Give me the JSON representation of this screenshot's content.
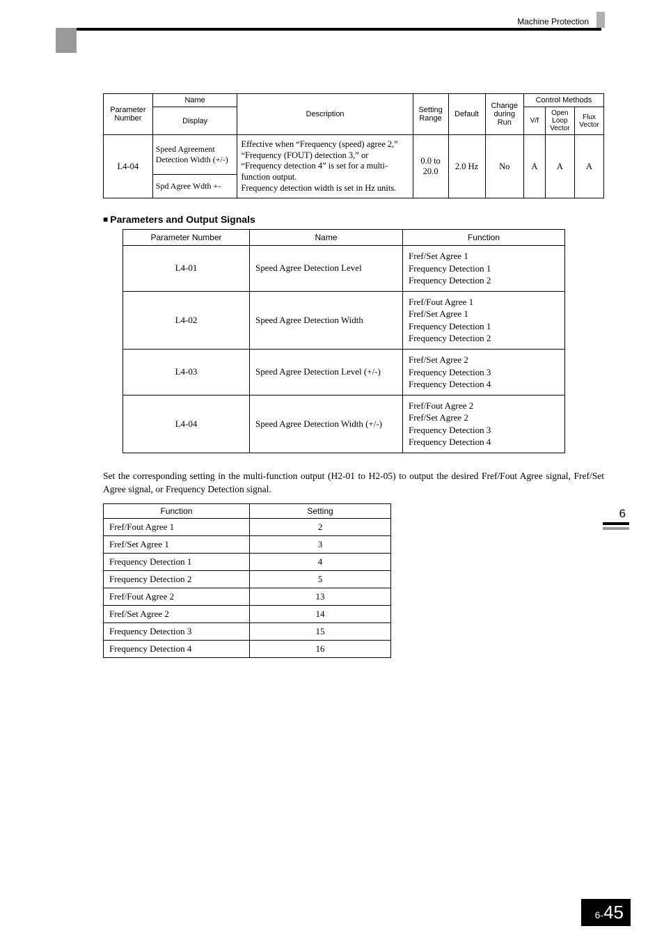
{
  "header": {
    "label": "Machine Protection"
  },
  "table1": {
    "head": {
      "param_no": "Parameter Number",
      "name": "Name",
      "display": "Display",
      "desc": "Description",
      "range": "Setting Range",
      "default": "Default",
      "change": "Change during Run",
      "control": "Control Methods",
      "vf": "V/f",
      "olv": "Open Loop Vector",
      "flux": "Flux Vector"
    },
    "row": {
      "pn": "L4-04",
      "name": "Speed Agreement Detection Width (+/-)",
      "disp": "Spd Agree Wdth +-",
      "desc": "Effective when “Frequency (speed) agree 2,” “Frequency (FOUT) detection 3,” or “Frequency detection 4” is set for a multi-function output.\nFrequency detection width is set in Hz units.",
      "range": "0.0 to 20.0",
      "default": "2.0 Hz",
      "change": "No",
      "vf": "A",
      "olv": "A",
      "flux": "A"
    }
  },
  "section": {
    "title": "Parameters and Output Signals"
  },
  "table2": {
    "head": {
      "pn": "Parameter Number",
      "name": "Name",
      "fn": "Function"
    },
    "rows": [
      {
        "pn": "L4-01",
        "name": "Speed Agree Detection Level",
        "fn": "Fref/Set Agree 1\nFrequency Detection 1\nFrequency Detection 2"
      },
      {
        "pn": "L4-02",
        "name": "Speed Agree Detection Width",
        "fn": "Fref/Fout Agree 1\nFref/Set Agree 1\nFrequency Detection 1\nFrequency Detection 2"
      },
      {
        "pn": "L4-03",
        "name": "Speed Agree Detection Level (+/-)",
        "fn": "Fref/Set Agree 2\nFrequency Detection 3\nFrequency Detection 4"
      },
      {
        "pn": "L4-04",
        "name": "Speed Agree Detection Width (+/-)",
        "fn": "Fref/Fout Agree 2\nFref/Set Agree 2\nFrequency Detection 3\nFrequency Detection 4"
      }
    ]
  },
  "paragraph": "Set the corresponding setting in the multi-function output (H2-01 to H2-05) to output the desired Fref/Fout Agree signal, Fref/Set Agree signal, or Frequency Detection signal.",
  "table3": {
    "head": {
      "fn": "Function",
      "setting": "Setting"
    },
    "rows": [
      {
        "fn": "Fref/Fout Agree 1",
        "setting": "2"
      },
      {
        "fn": "Fref/Set Agree 1",
        "setting": "3"
      },
      {
        "fn": "Frequency Detection 1",
        "setting": "4"
      },
      {
        "fn": "Frequency Detection 2",
        "setting": "5"
      },
      {
        "fn": "Fref/Fout Agree 2",
        "setting": "13"
      },
      {
        "fn": "Fref/Set Agree 2",
        "setting": "14"
      },
      {
        "fn": "Frequency Detection 3",
        "setting": "15"
      },
      {
        "fn": "Frequency Detection 4",
        "setting": "16"
      }
    ]
  },
  "side": {
    "chapter": "6"
  },
  "footer": {
    "prefix": "6-",
    "page": "45"
  }
}
